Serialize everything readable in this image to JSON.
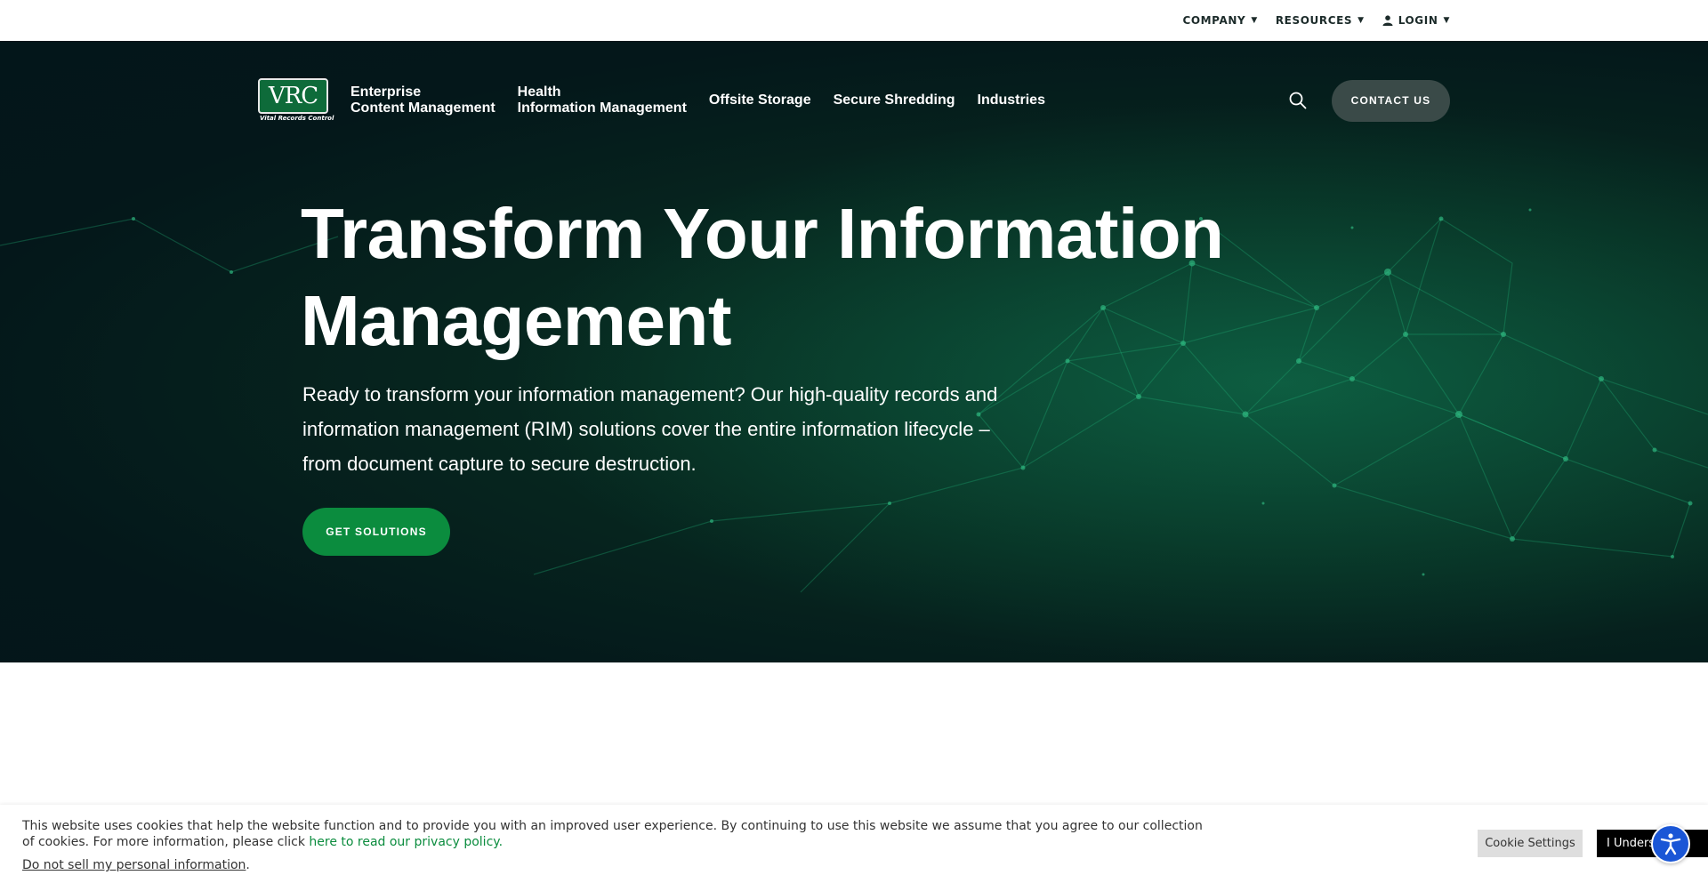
{
  "utility_nav": {
    "company": "COMPANY",
    "resources": "RESOURCES",
    "login": "LOGIN"
  },
  "logo": {
    "mark": "VRC",
    "tagline": "Vital Records Control"
  },
  "main_nav": {
    "items": [
      {
        "line1": "Enterprise",
        "line2": "Content Management"
      },
      {
        "line1": "Health",
        "line2": "Information Management"
      },
      {
        "line1": "Offsite Storage",
        "line2": ""
      },
      {
        "line1": "Secure Shredding",
        "line2": ""
      },
      {
        "line1": "Industries",
        "line2": ""
      }
    ],
    "contact": "CONTACT US",
    "search_icon": "search-icon"
  },
  "hero": {
    "title_line1": "Transform Your Information",
    "title_line2": "Management",
    "subtitle": "Ready to transform your information management? Our high-quality records and information management (RIM) solutions cover the entire information lifecycle – from document capture to secure destruction.",
    "cta": "GET SOLUTIONS"
  },
  "cookie": {
    "text": "This website uses cookies that help the website function and to provide you with an improved user experience. By continuing to use this website we assume that you agree to our collection of cookies. For more information, please click ",
    "link": "here to read our privacy policy.",
    "do_not_sell": "Do not sell my personal information",
    "do_not_sell_suffix": ".",
    "settings": "Cookie Settings",
    "accept": "I Understand"
  },
  "colors": {
    "brand_green": "#0b8c3e",
    "hero_bg": "#04171a",
    "contact_bg": "#3a4a48",
    "accessibility_blue": "#1a56d6"
  }
}
